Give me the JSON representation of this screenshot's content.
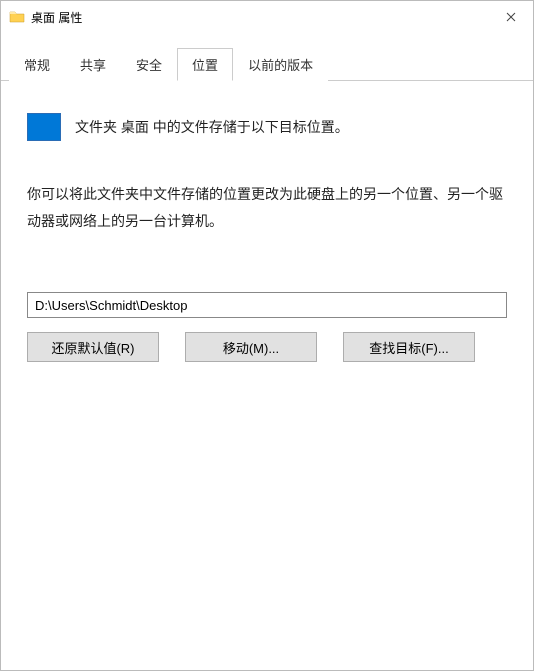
{
  "window": {
    "title": "桌面 属性"
  },
  "tabs": {
    "general": "常规",
    "share": "共享",
    "security": "安全",
    "location": "位置",
    "previous": "以前的版本"
  },
  "content": {
    "folder_desc": "文件夹 桌面 中的文件存储于以下目标位置。",
    "info_para": "你可以将此文件夹中文件存储的位置更改为此硬盘上的另一个位置、另一个驱动器或网络上的另一台计算机。",
    "path_value": "D:\\Users\\Schmidt\\Desktop",
    "restore_btn": "还原默认值(R)",
    "move_btn": "移动(M)...",
    "find_btn": "查找目标(F)..."
  }
}
